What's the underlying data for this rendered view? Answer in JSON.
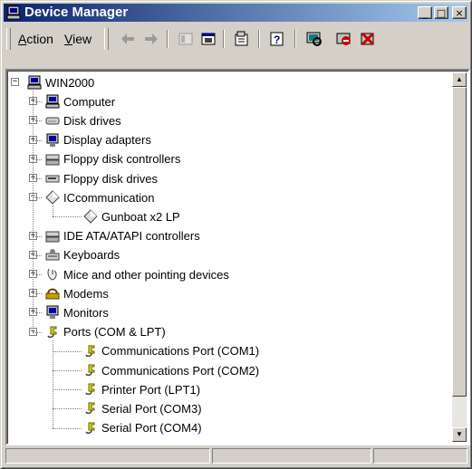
{
  "window": {
    "title": "Device Manager"
  },
  "title_buttons": {
    "minimize": "_",
    "maximize": "□",
    "close": "×"
  },
  "menu": {
    "action": {
      "accel": "A",
      "rest": "ction"
    },
    "view": {
      "accel": "V",
      "rest": "iew"
    }
  },
  "toolbar": {
    "icons": [
      "back-arrow-icon",
      "forward-arrow-icon",
      "show-hide-tree-icon",
      "details-icon",
      "properties-icon",
      "help-icon",
      "scan-hardware-icon",
      "disable-device-icon",
      "uninstall-device-icon"
    ]
  },
  "tree": {
    "root": "WIN2000",
    "categories": [
      {
        "label": "Computer",
        "icon": "computer-icon",
        "expanded": false
      },
      {
        "label": "Disk drives",
        "icon": "disk-drive-icon",
        "expanded": false
      },
      {
        "label": "Display adapters",
        "icon": "display-adapter-icon",
        "expanded": false
      },
      {
        "label": "Floppy disk controllers",
        "icon": "controller-icon",
        "expanded": false
      },
      {
        "label": "Floppy disk drives",
        "icon": "floppy-drive-icon",
        "expanded": false
      },
      {
        "label": "ICcommunication",
        "icon": "diamond-device-icon",
        "expanded": true,
        "children": [
          {
            "label": "Gunboat x2 LP",
            "icon": "diamond-device-icon"
          }
        ]
      },
      {
        "label": "IDE ATA/ATAPI controllers",
        "icon": "controller-icon",
        "expanded": false
      },
      {
        "label": "Keyboards",
        "icon": "keyboard-icon",
        "expanded": false
      },
      {
        "label": "Mice and other pointing devices",
        "icon": "mouse-icon",
        "expanded": false
      },
      {
        "label": "Modems",
        "icon": "modem-icon",
        "expanded": false
      },
      {
        "label": "Monitors",
        "icon": "monitor-icon",
        "expanded": false
      },
      {
        "label": "Ports (COM & LPT)",
        "icon": "port-icon",
        "expanded": true,
        "children": [
          {
            "label": "Communications Port (COM1)",
            "icon": "port-icon"
          },
          {
            "label": "Communications Port (COM2)",
            "icon": "port-icon"
          },
          {
            "label": "Printer Port (LPT1)",
            "icon": "port-icon"
          },
          {
            "label": "Serial Port (COM3)",
            "icon": "port-icon"
          },
          {
            "label": "Serial Port (COM4)",
            "icon": "port-icon"
          }
        ]
      }
    ]
  },
  "colors": {
    "titlebar_start": "#0a246a",
    "titlebar_end": "#a6caf0",
    "face": "#d4d0c8"
  }
}
